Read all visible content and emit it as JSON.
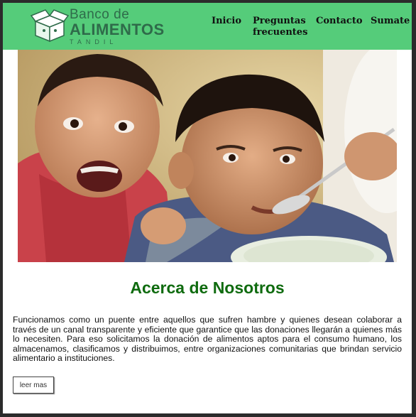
{
  "logo": {
    "line1": "Banco de",
    "line2": "ALIMENTOS",
    "line3": "TANDIL"
  },
  "nav": {
    "items": [
      "Inicio",
      "Preguntas frecuentes",
      "Contacto",
      "Sumate"
    ]
  },
  "hero": {
    "image": "children-eating-photo"
  },
  "about": {
    "title": "Acerca de Nosotros",
    "text": "Funcionamos como un puente entre aquellos que sufren hambre y quienes desean colaborar a través de un canal transparente y eficiente que garantice que las donaciones llegarán a quienes más lo necesiten. Para eso solicitamos la donación de alimentos aptos para el consumo humano, los almacenamos, clasificamos y distribuimos, entre organizaciones comunitarias que brindan servicio alimentario a instituciones.",
    "button": "leer mas"
  },
  "colors": {
    "header": "#55cc7a",
    "title": "#0f6b0f",
    "logo": "#2f6b4a"
  }
}
